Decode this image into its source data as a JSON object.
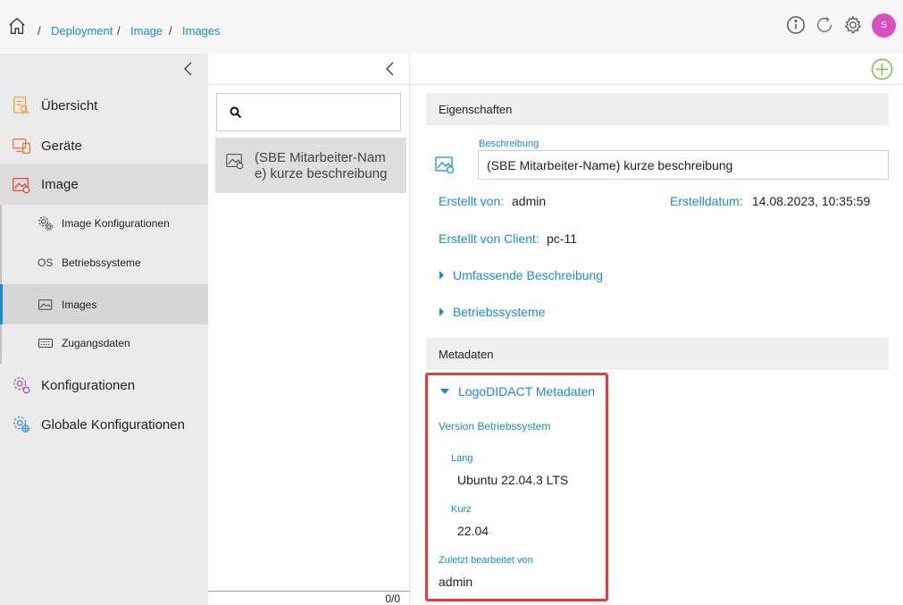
{
  "breadcrumb": {
    "items": [
      "Deployment",
      "Image",
      "Images"
    ],
    "separator": "/"
  },
  "header": {
    "avatar_initial": "S"
  },
  "sidebar": {
    "items": [
      {
        "label": "Übersicht",
        "icon": "overview-icon"
      },
      {
        "label": "Geräte",
        "icon": "devices-icon"
      },
      {
        "label": "Image",
        "icon": "image-icon"
      },
      {
        "label": "Image Konfigurationen",
        "icon": "gears-icon"
      },
      {
        "label": "Betriebssysteme",
        "icon": "os-icon",
        "icon_text": "OS"
      },
      {
        "label": "Images",
        "icon": "image-small-icon"
      },
      {
        "label": "Zugangsdaten",
        "icon": "keyboard-icon"
      },
      {
        "label": "Konfigurationen",
        "icon": "config-icon"
      },
      {
        "label": "Globale Konfigurationen",
        "icon": "global-config-icon"
      }
    ]
  },
  "list": {
    "search_placeholder": "",
    "items": [
      {
        "label": "(SBE Mitarbeiter-Name) kurze beschreibung"
      }
    ],
    "count": "0/0"
  },
  "detail": {
    "properties_title": "Eigenschaften",
    "description_label": "Beschreibung",
    "description_value": "(SBE Mitarbeiter-Name) kurze beschreibung",
    "created_by_label": "Erstellt von:",
    "created_by_value": "admin",
    "created_date_label": "Erstelldatum:",
    "created_date_value": "14.08.2023, 10:35:59",
    "created_client_label": "Erstellt von Client:",
    "created_client_value": "pc-11",
    "expanders": [
      "Umfassende Beschreibung",
      "Betriebssysteme"
    ],
    "metadata_title": "Metadaten",
    "metadata_group": "LogoDIDACT Metadaten",
    "os_version_label": "Version Betriebssystem",
    "long_label": "Lang",
    "long_value": "Ubuntu 22.04.3 LTS",
    "short_label": "Kurz",
    "short_value": "22.04",
    "last_edited_label": "Zuletzt bearbeitet von",
    "last_edited_value": "admin"
  },
  "colors": {
    "accent": "#1a8ccf",
    "highlight": "#e53b3b",
    "avatar": "#d94fbf",
    "add": "#7cc242"
  }
}
